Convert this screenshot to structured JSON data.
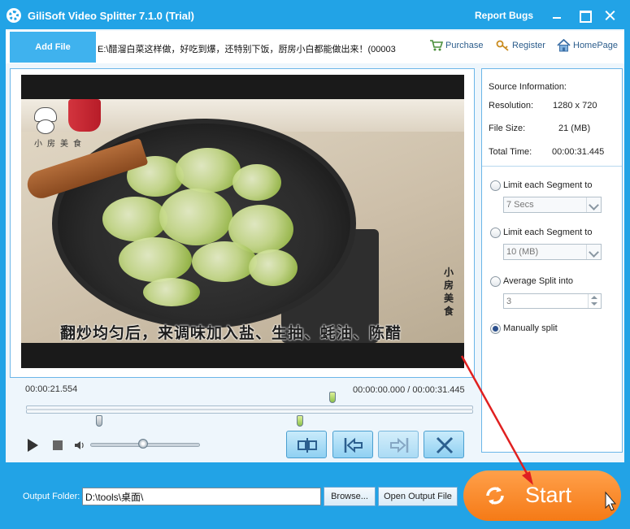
{
  "window": {
    "title": "GiliSoft Video Splitter 7.1.0 (Trial)",
    "report_bugs": "Report Bugs"
  },
  "toolbar": {
    "add_file": "Add File",
    "file_path": "E:\\醋溜白菜这样做，好吃到爆，还特别下饭，厨房小白都能做出来！(00003",
    "purchase": "Purchase",
    "register": "Register",
    "homepage": "HomePage"
  },
  "video": {
    "subtitle": "翻炒均匀后，来调味加入盐、生抽、蚝油、陈醋",
    "watermark_vertical": "小房美食",
    "watermark_logo": "小房美食",
    "current_time": "00:00:21.554",
    "range_time": "00:00:00.000 / 00:00:31.445",
    "position_fraction": 0.6854,
    "volume_fraction": 0.48
  },
  "source_info": {
    "heading": "Source Information:",
    "resolution_label": "Resolution:",
    "resolution_value": "1280 x 720",
    "file_size_label": "File Size:",
    "file_size_value": "21 (MB)",
    "total_time_label": "Total Time:",
    "total_time_value": "00:00:31.445"
  },
  "split_options": {
    "limit_time_label": "Limit each Segment to",
    "limit_time_value": "7 Secs",
    "limit_size_label": "Limit each Segment to",
    "limit_size_value": "10 (MB)",
    "average_label": "Average Split into",
    "average_value": "3",
    "manual_label": "Manually split",
    "selected": "manual"
  },
  "footer": {
    "output_folder_label": "Output Folder:",
    "output_folder_value": "D:\\tools\\桌面\\",
    "browse": "Browse...",
    "open_output": "Open Output File",
    "start": "Start"
  },
  "colors": {
    "accent": "#22a3e6",
    "start": "#f7871e",
    "arrow": "#e02020"
  }
}
